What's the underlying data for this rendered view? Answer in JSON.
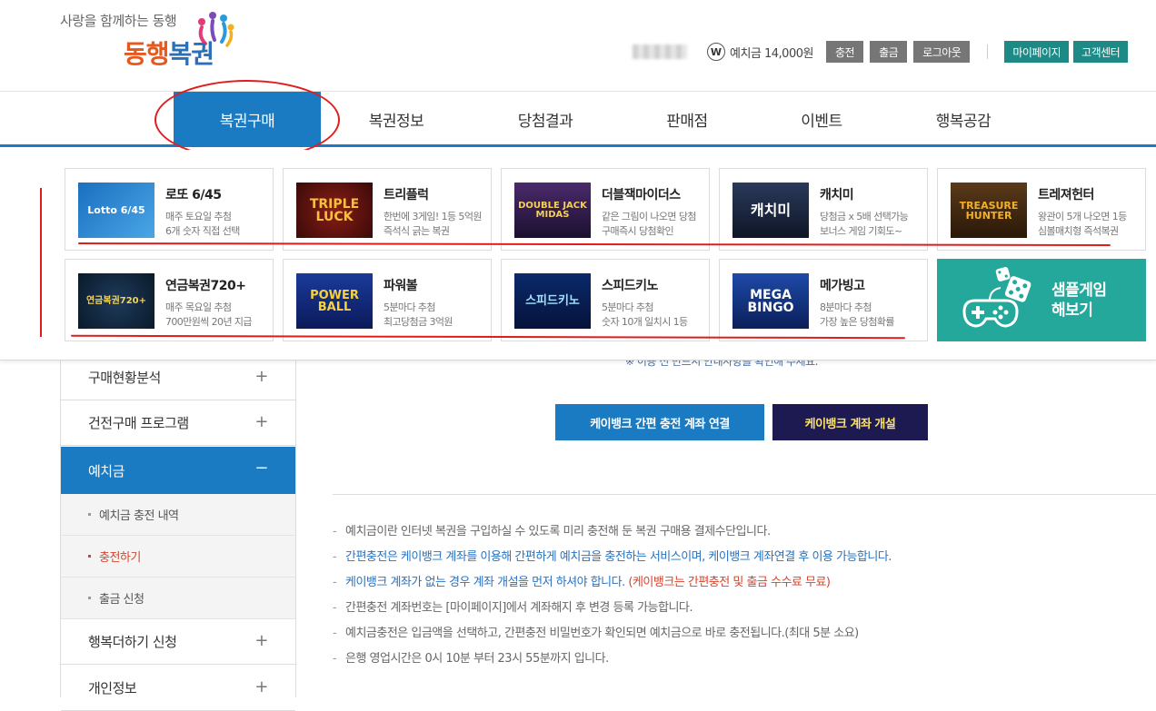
{
  "header": {
    "logo_tagline": "사랑을 함께하는 동행",
    "logo_name_a": "동행",
    "logo_name_b": "복권",
    "won_symbol": "W",
    "deposit_text": "예치금 14,000원",
    "btn_charge": "충전",
    "btn_withdraw": "출금",
    "btn_logout": "로그아웃",
    "btn_mypage": "마이페이지",
    "btn_support": "고객센터"
  },
  "nav": {
    "items": [
      "복권구매",
      "복권정보",
      "당첨결과",
      "판매점",
      "이벤트",
      "행복공감"
    ]
  },
  "games": [
    {
      "thumb": "Lotto 6/45",
      "title": "로또 6/45",
      "d1": "매주 토요일 추첨",
      "d2": "6개 숫자 직접 선택"
    },
    {
      "thumb": "TRIPLE LUCK",
      "title": "트리플럭",
      "d1": "한번에 3게임! 1등 5억원",
      "d2": "즉석식 긁는 복권"
    },
    {
      "thumb": "DOUBLE JACK MIDAS",
      "title": "더블잭마이더스",
      "d1": "같은 그림이 나오면 당첨",
      "d2": "구매즉시 당첨확인"
    },
    {
      "thumb": "캐치미",
      "title": "캐치미",
      "d1": "당첨금 x 5배 선택가능",
      "d2": "보너스 게임 기회도~"
    },
    {
      "thumb": "TREASURE HUNTER",
      "title": "트레져헌터",
      "d1": "왕관이 5개 나오면 1등",
      "d2": "심볼매치형 즉석복권"
    },
    {
      "thumb": "연금복권720+",
      "title": "연금복권720+",
      "d1": "매주 목요일 추첨",
      "d2": "700만원씩 20년 지급"
    },
    {
      "thumb": "POWER BALL",
      "title": "파워볼",
      "d1": "5분마다 추첨",
      "d2": "최고당첨금 3억원"
    },
    {
      "thumb": "스피드키노",
      "title": "스피드키노",
      "d1": "5분마다 추첨",
      "d2": "숫자 10개 일치시 1등"
    },
    {
      "thumb": "MEGA BINGO",
      "title": "메가빙고",
      "d1": "8분마다 추첨",
      "d2": "가장 높은 당첨확률"
    }
  ],
  "sample_game": {
    "line1": "샘플게임",
    "line2": "해보기"
  },
  "lnb": {
    "items": [
      "구매현황분석",
      "건전구매 프로그램",
      "예치금",
      "행복더하기 신청",
      "개인정보"
    ],
    "subs": [
      "예치금 충전 내역",
      "충전하기",
      "출금 신청"
    ],
    "plus": "+",
    "minus": "−"
  },
  "content": {
    "hidden_text": "※ 이용 전 반드시 안내사항을 확인해 주세요.",
    "btn_link": "케이뱅크 간편 충전 계좌 연결",
    "btn_open": "케이뱅크 계좌 개설",
    "bullet": "-",
    "notes": [
      "예치금이란 인터넷 복권을 구입하실 수 있도록 미리 충전해 둔 복권 구매용 결제수단입니다.",
      "간편충전은 케이뱅크 계좌를 이용해 간편하게 예치금을 충전하는 서비스이며, 케이뱅크 계좌연결 후 이용 가능합니다.",
      "케이뱅크 계좌가 없는 경우 계좌 개설을 먼저 하셔야 합니다.",
      "간편충전 계좌번호는 [마이페이지]에서 계좌해지 후 변경 등록 가능합니다.",
      "예치금충전은 입금액을 선택하고, 간편충전 비밀번호가 확인되면 예치금으로 바로 충전됩니다.(최대 5분 소요)",
      "은행 영업시간은 0시 10분 부터 23시 55분까지 입니다."
    ],
    "note3_red": "(케이뱅크는 간편충전 및 출금 수수료 무료)"
  },
  "colors": {
    "primary": "#1a7ac2",
    "teal": "#24a89b",
    "navy": "#1d1a52",
    "annotation": "#e01d1d"
  }
}
